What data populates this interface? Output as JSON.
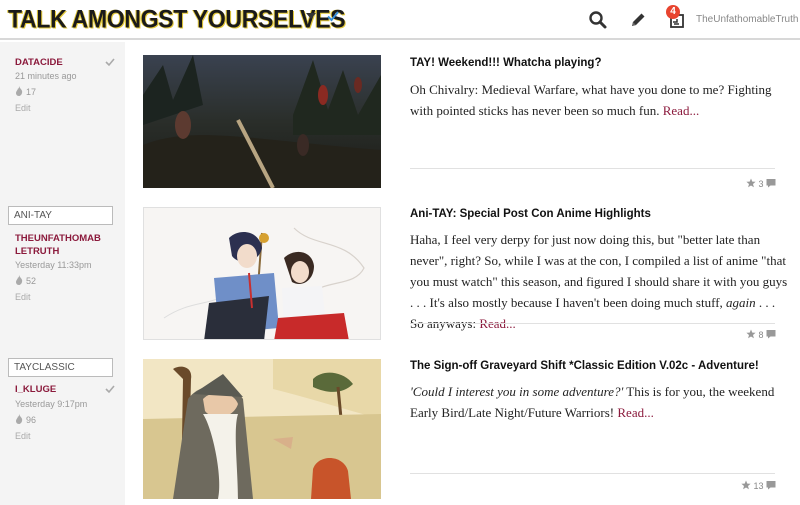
{
  "header": {
    "logo": "TALK AMONGST YOURSELVES",
    "username": "TheUnfathomableTruth",
    "notification_count": "4",
    "accent_color": "#e3c93a"
  },
  "posts": [
    {
      "tag": "",
      "author": "DATACIDE",
      "time": "21 minutes ago",
      "likes": "17",
      "edit": "Edit",
      "title": "TAY! Weekend!!! Whatcha playing?",
      "body": "Oh Chivalry: Medieval Warfare, what have you done to me? Fighting with pointed sticks has never been so much fun.",
      "read_more": "Read...",
      "stars": "3"
    },
    {
      "tag": "ANI-TAY",
      "author": "THEUNFATHOMABLETRUTH",
      "time": "Yesterday 11:33pm",
      "likes": "52",
      "edit": "Edit",
      "title": "Ani-TAY: Special Post Con Anime Highlights",
      "body": "Haha, I feel very derpy for just now doing this, but \"better late than never\", right? So, while I was at the con, I compiled a list of anime \"that you must watch\" this season, and figured I should share it with you guys . . . It's also mostly because I haven't been doing much stuff,",
      "body_italic": "again",
      "body_tail": ". . . So anyways:",
      "read_more": "Read...",
      "stars": "8"
    },
    {
      "tag": "TAYCLASSIC",
      "author": "I_KLUGE",
      "time": "Yesterday 9:17pm",
      "likes": "96",
      "edit": "Edit",
      "title": "The Sign-off Graveyard Shift *Classic Edition V.02c - Adventure!",
      "body_italic": "'Could I interest you in some adventure?'",
      "body": "This is for you, the weekend Early Bird/Late Night/Future Warriors!",
      "read_more": "Read...",
      "stars": "13"
    }
  ]
}
